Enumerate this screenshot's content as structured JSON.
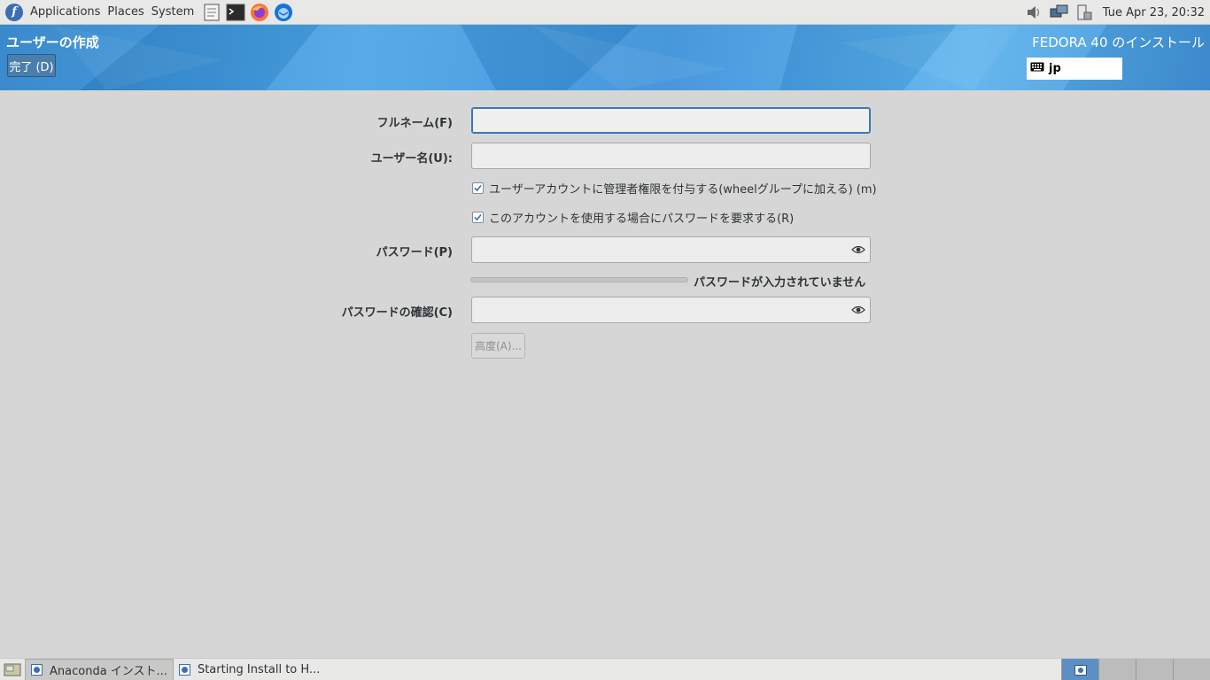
{
  "top_panel": {
    "menus": [
      "Applications",
      "Places",
      "System"
    ],
    "launchers": [
      "text-editor-icon",
      "terminal-icon",
      "firefox-icon",
      "thunderbird-icon"
    ],
    "tray": [
      "volume-icon",
      "network-icon",
      "battery-icon"
    ],
    "clock": "Tue Apr 23, 20:32"
  },
  "header": {
    "spoke_title": "ユーザーの作成",
    "done_label": "完了 (D)",
    "product_title": "FEDORA 40 のインストール",
    "keyboard_layout": "jp",
    "accent": "#3a90d9"
  },
  "form": {
    "fullname_label": "フルネーム(F)",
    "fullname_value": "",
    "username_label": "ユーザー名(U):",
    "username_value": "",
    "admin_checkbox": {
      "label": "ユーザーアカウントに管理者権限を付与する(wheelグループに加える) (m)",
      "checked": true
    },
    "require_password_checkbox": {
      "label": "このアカウントを使用する場合にパスワードを要求する(R)",
      "checked": true
    },
    "password_label": "パスワード(P)",
    "password_value": "",
    "strength_text": "パスワードが入力されていません",
    "strength_level": 0,
    "confirm_label": "パスワードの確認(C)",
    "confirm_value": "",
    "advanced_label": "高度(A)..."
  },
  "bottom_panel": {
    "tasks": [
      "Anaconda インスト...",
      "Starting Install to H..."
    ],
    "workspaces": 4
  }
}
